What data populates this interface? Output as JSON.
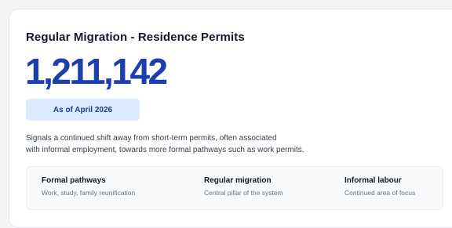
{
  "card": {
    "title": "Regular Migration - Residence Permits",
    "total": "1,211,142",
    "as_of": "As of April 2026",
    "description_lines": [
      "Signals a continued shift away from short-term permits, often associated",
      "with informal employment, towards more formal pathways such as work permits."
    ]
  },
  "pathways": [
    {
      "title": "Formal pathways",
      "subtitle": "Work, study, family reunification"
    },
    {
      "title": "Regular migration",
      "subtitle": "Central pillar of the system"
    },
    {
      "title": "Informal labour",
      "subtitle": "Continued area of focus"
    }
  ],
  "colors": {
    "accent": "#1d3fae",
    "badge_bg": "#dbeafe"
  }
}
